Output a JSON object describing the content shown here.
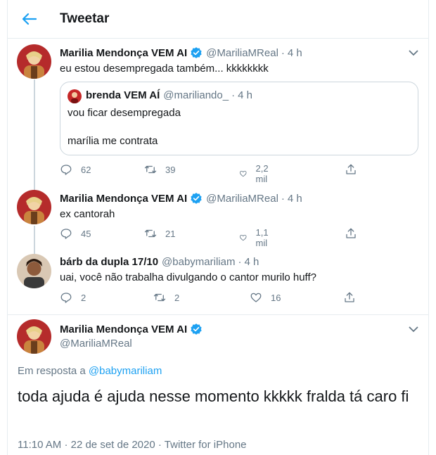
{
  "header": {
    "title": "Tweetar"
  },
  "tweet1": {
    "name": "Marilia Mendonça VEM AI",
    "handle": "@MariliaMReal",
    "time": "4 h",
    "text": "eu estou desempregada também... kkkkkkkk",
    "quote": {
      "name": "brenda VEM AÍ",
      "handle": "@mariliando_",
      "time": "4 h",
      "line1": "vou ficar desempregada",
      "line2": "marília me contrata"
    },
    "replies": "62",
    "retweets": "39",
    "likes": "2,2 mil"
  },
  "tweet2": {
    "name": "Marilia Mendonça VEM AI",
    "handle": "@MariliaMReal",
    "time": "4 h",
    "text": "ex cantorah",
    "replies": "45",
    "retweets": "21",
    "likes": "1,1 mil"
  },
  "tweet3": {
    "name": "bárb da dupla 17/10",
    "handle": "@babymariliam",
    "time": "4 h",
    "text": "uai, você não trabalha divulgando o cantor murilo huff?",
    "replies": "2",
    "retweets": "2",
    "likes": "16"
  },
  "main": {
    "name": "Marilia Mendonça VEM AI",
    "handle": "@MariliaMReal",
    "reply_prefix": "Em resposta a ",
    "reply_handle": "@babymariliam",
    "text": "toda ajuda é ajuda nesse momento kkkkk fralda tá caro fi",
    "time": "11:10 AM",
    "date": "22 de set de 2020",
    "source": "Twitter for iPhone"
  },
  "colors": {
    "accent": "#1da1f2",
    "muted": "#657786",
    "border": "#e6ecf0"
  },
  "icons": [
    "back-arrow-icon",
    "verified-icon",
    "chevron-down-icon",
    "reply-icon",
    "retweet-icon",
    "like-icon",
    "share-icon"
  ]
}
